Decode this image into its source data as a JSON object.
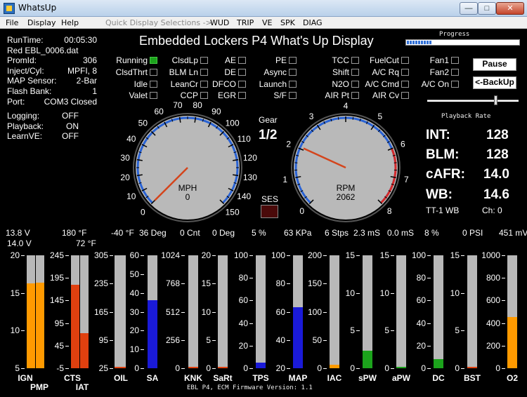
{
  "window": {
    "title": "WhatsUp",
    "min": "—",
    "max": "□",
    "close": "✕"
  },
  "menu": {
    "items": [
      "File",
      "Display",
      "Help"
    ],
    "quick": "Quick Display Selections ->",
    "extra": [
      "WUD",
      "TRIP",
      "VE",
      "SPK",
      "DIAG"
    ]
  },
  "info": {
    "runtime": {
      "label": "RunTime:",
      "value": "00:05:30"
    },
    "file": "Red EBL_0006.dat",
    "promid": {
      "label": "PromId:",
      "value": "306"
    },
    "inject": {
      "label": "Inject/Cyl:",
      "value": "MPFI,  8"
    },
    "map_sensor": {
      "label": "MAP Sensor:",
      "value": "2-Bar"
    },
    "flash_bank": {
      "label": "Flash Bank:",
      "value": "1"
    },
    "port": {
      "label": "Port:",
      "value": "COM3  Closed"
    },
    "logging": {
      "label": "Logging:",
      "value": "OFF"
    },
    "playback": {
      "label": "Playback:",
      "value": "ON"
    },
    "learnve": {
      "label": "LearnVE:",
      "value": "OFF"
    }
  },
  "header": {
    "title": "Embedded Lockers P4 What's Up Display",
    "progress_label": "Progress",
    "progress": 0.22
  },
  "indicators": [
    {
      "label": "Running",
      "on": true
    },
    {
      "label": "ClsdLp",
      "on": false
    },
    {
      "label": "AE",
      "on": false
    },
    {
      "label": "PE",
      "on": false
    },
    {
      "label": "TCC",
      "on": false
    },
    {
      "label": "FuelCut",
      "on": false
    },
    {
      "label": "Fan1",
      "on": false
    },
    {
      "label": "ClsdThrt",
      "on": false
    },
    {
      "label": "BLM Ln",
      "on": false
    },
    {
      "label": "DE",
      "on": false
    },
    {
      "label": "Async",
      "on": false
    },
    {
      "label": "Shift",
      "on": false
    },
    {
      "label": "A/C Rq",
      "on": false
    },
    {
      "label": "Fan2",
      "on": false
    },
    {
      "label": "Idle",
      "on": false
    },
    {
      "label": "LeanCr",
      "on": false
    },
    {
      "label": "DFCO",
      "on": false
    },
    {
      "label": "Launch",
      "on": false
    },
    {
      "label": "N2O",
      "on": false
    },
    {
      "label": "A/C Cmd",
      "on": false
    },
    {
      "label": "A/C On",
      "on": false
    },
    {
      "label": "Valet",
      "on": false
    },
    {
      "label": "CCP",
      "on": false
    },
    {
      "label": "EGR",
      "on": false
    },
    {
      "label": "S/F",
      "on": false
    },
    {
      "label": "AIR Pt",
      "on": false
    },
    {
      "label": "AIR Cv",
      "on": false
    }
  ],
  "controls": {
    "pause": "Pause",
    "backup": "<-BackUp",
    "playback_rate": "Playback Rate",
    "playback_rate_value": 0.75
  },
  "readouts": {
    "int": {
      "label": "INT:",
      "value": "128"
    },
    "blm": {
      "label": "BLM:",
      "value": "128"
    },
    "cafr": {
      "label": "cAFR:",
      "value": "14.0"
    },
    "wb": {
      "label": "WB:",
      "value": "14.6"
    },
    "tt": "TT-1 WB",
    "ch": "Ch: 0"
  },
  "gear": {
    "label": "Gear",
    "value": "1/2"
  },
  "ses": {
    "label": "SES"
  },
  "mph": {
    "label": "MPH",
    "value": "0",
    "min": 0,
    "max": 150,
    "current": 0,
    "ticks": [
      "0",
      "10",
      "20",
      "30",
      "40",
      "50",
      "60",
      "70",
      "80",
      "90",
      "100",
      "110",
      "120",
      "130",
      "140",
      "150"
    ],
    "red_from": 150
  },
  "rpm": {
    "label": "RPM",
    "value": "2062",
    "min": 0,
    "max": 8,
    "current": 2.062,
    "ticks": [
      "0",
      "1",
      "2",
      "3",
      "4",
      "5",
      "6",
      "7",
      "8"
    ],
    "red_from": 6
  },
  "bars": [
    {
      "name": "IGN",
      "top": "13.8 V",
      "max": 20,
      "min": -5,
      "value": 13.8,
      "color": "#ff9a00",
      "scale": [
        "20",
        "15",
        "10",
        "5"
      ]
    },
    {
      "name": "PMP",
      "top": "14.0 V",
      "max": 20,
      "min": -5,
      "value": 14.0,
      "color": "#ff9a00"
    },
    {
      "name": "CTS",
      "top": "180 °F",
      "max": 245,
      "min": -5,
      "value": 180,
      "color": "#e0400f",
      "scale": [
        "245",
        "195",
        "145",
        "95",
        "45",
        "-5"
      ]
    },
    {
      "name": "IAT",
      "top": "72 °F",
      "max": 245,
      "min": -5,
      "value": 72,
      "color": "#e0400f"
    },
    {
      "name": "OIL",
      "top": "-40 °F",
      "max": 305,
      "min": 25,
      "value": 25,
      "color": "#e0400f",
      "scale": [
        "305",
        "235",
        "165",
        "95",
        "25"
      ]
    },
    {
      "name": "SA",
      "top": "36 Deg",
      "max": 60,
      "min": 0,
      "value": 36,
      "color": "#1a1ad8",
      "scale": [
        "60",
        "50",
        "40",
        "30",
        "20",
        "10",
        "0"
      ]
    },
    {
      "name": "KNK",
      "top": "0 Cnt",
      "max": 1024,
      "min": 0,
      "value": 0,
      "color": "#e0400f",
      "scale": [
        "1024",
        "768",
        "512",
        "256",
        "0"
      ]
    },
    {
      "name": "SaRt",
      "top": "0 Deg",
      "max": 20,
      "min": 0,
      "value": 0,
      "color": "#e0400f",
      "scale": [
        "20",
        "15",
        "10",
        "5",
        "0"
      ]
    },
    {
      "name": "TPS",
      "top": "5 %",
      "max": 100,
      "min": 0,
      "value": 5,
      "color": "#1a1ad8",
      "scale": [
        "100",
        "80",
        "60",
        "40",
        "20",
        "0"
      ]
    },
    {
      "name": "MAP",
      "top": "63 KPa",
      "max": 100,
      "min": 20,
      "value": 63,
      "color": "#1a1ad8",
      "scale": [
        "100",
        "80",
        "60",
        "40",
        "20"
      ]
    },
    {
      "name": "IAC",
      "top": "6 Stps",
      "max": 200,
      "min": 0,
      "value": 6,
      "color": "#ff9a00",
      "scale": [
        "200",
        "150",
        "100",
        "50",
        "0"
      ]
    },
    {
      "name": "sPW",
      "top": "2.3 mS",
      "max": 15,
      "min": 0,
      "value": 2.3,
      "color": "#1ca31c",
      "scale": [
        "15",
        "10",
        "5",
        "0"
      ]
    },
    {
      "name": "aPW",
      "top": "0.0 mS",
      "max": 15,
      "min": 0,
      "value": 0.0,
      "color": "#1ca31c",
      "scale": [
        "15",
        "10",
        "5",
        "0"
      ]
    },
    {
      "name": "DC",
      "top": "8 %",
      "max": 100,
      "min": 0,
      "value": 8,
      "color": "#1ca31c",
      "scale": [
        "100",
        "80",
        "60",
        "40",
        "20",
        "0"
      ]
    },
    {
      "name": "BST",
      "top": "0 PSI",
      "max": 15,
      "min": 0,
      "value": 0,
      "color": "#e0400f",
      "scale": [
        "15",
        "10",
        "5",
        "0"
      ]
    },
    {
      "name": "O2",
      "top": "451 mV",
      "max": 1000,
      "min": 0,
      "value": 451,
      "color": "#ff9a00",
      "scale": [
        "1000",
        "800",
        "600",
        "400",
        "200",
        "0"
      ]
    }
  ],
  "footer": {
    "firmware": "EBL P4, ECM Firmware Version: 1.1"
  }
}
